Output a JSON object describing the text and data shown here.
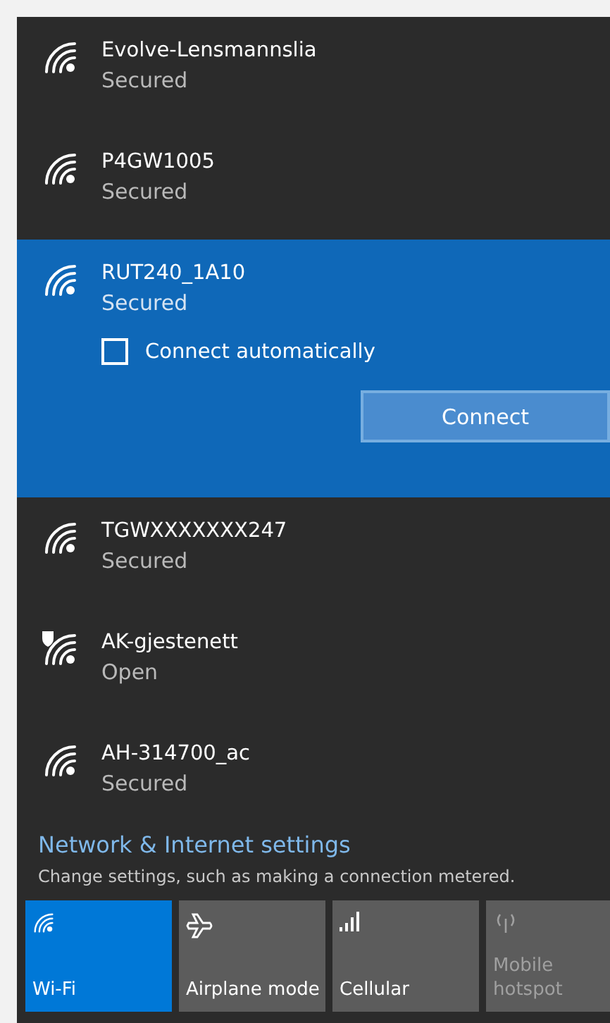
{
  "networks": [
    {
      "name": "Evolve-Lensmannslia",
      "status": "Secured",
      "kind": "secured",
      "selected": false
    },
    {
      "name": "P4GW1005",
      "status": "Secured",
      "kind": "secured",
      "selected": false
    },
    {
      "name": "RUT240_1A10",
      "status": "Secured",
      "kind": "secured",
      "selected": true,
      "connect_automatically": {
        "label": "Connect automatically",
        "checked": false
      },
      "connect_button": "Connect"
    },
    {
      "name": "TGWXXXXXXX247",
      "status": "Secured",
      "kind": "secured",
      "selected": false
    },
    {
      "name": "AK-gjestenett",
      "status": "Open",
      "kind": "open",
      "selected": false
    },
    {
      "name": "AH-314700_ac",
      "status": "Secured",
      "kind": "secured",
      "selected": false
    }
  ],
  "settings_link": {
    "title": "Network & Internet settings",
    "description": "Change settings, such as making a connection metered."
  },
  "quick_actions": [
    {
      "kind": "wifi",
      "label": "Wi-Fi",
      "selected": true,
      "disabled": false
    },
    {
      "kind": "airplane",
      "label": "Airplane mode",
      "selected": false,
      "disabled": false
    },
    {
      "kind": "cellular",
      "label": "Cellular",
      "selected": false,
      "disabled": false
    },
    {
      "kind": "hotspot",
      "label": "Mobile hotspot",
      "selected": false,
      "disabled": true
    }
  ]
}
